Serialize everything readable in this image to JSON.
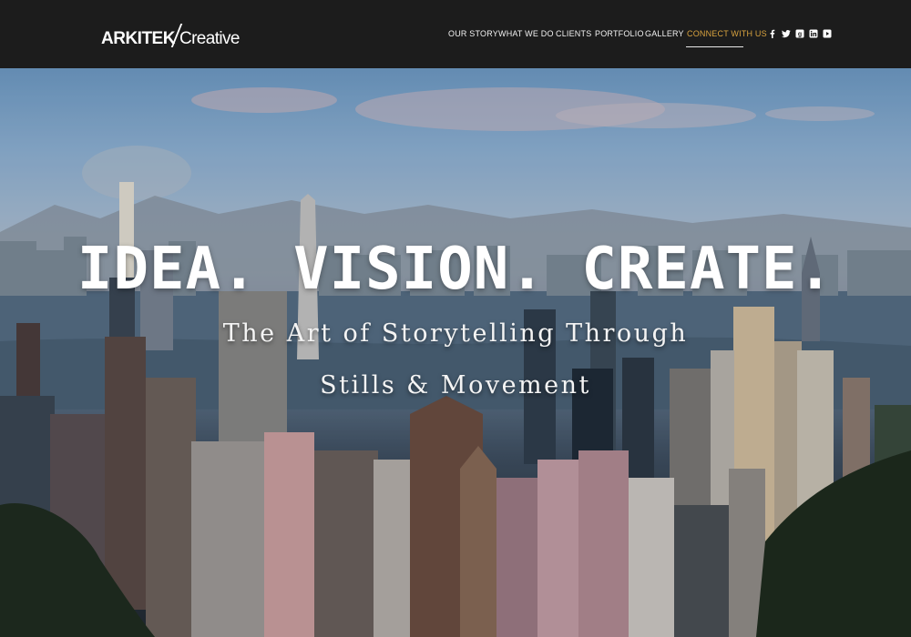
{
  "brand": {
    "logo_bold": "ARKITEK",
    "logo_light": "Creative"
  },
  "nav": {
    "items": [
      {
        "label": "OUR STORY"
      },
      {
        "label": "WHAT WE DO"
      },
      {
        "label": "CLIENTS"
      },
      {
        "label": "PORTFOLIO"
      },
      {
        "label": "GALLERY"
      },
      {
        "label": "CONNECT WITH US"
      }
    ],
    "active_index": 5,
    "active_color": "#d9a33f"
  },
  "social": [
    "facebook-icon",
    "twitter-icon",
    "google-plus-icon",
    "linkedin-icon",
    "youtube-icon"
  ],
  "hero": {
    "headline": "IDEA. VISION. CREATE.",
    "subtitle_line1": "The Art of Storytelling Through",
    "subtitle_line2": "Stills & Movement"
  },
  "colors": {
    "header_bg": "#1c1c1c",
    "text": "#ffffff"
  }
}
